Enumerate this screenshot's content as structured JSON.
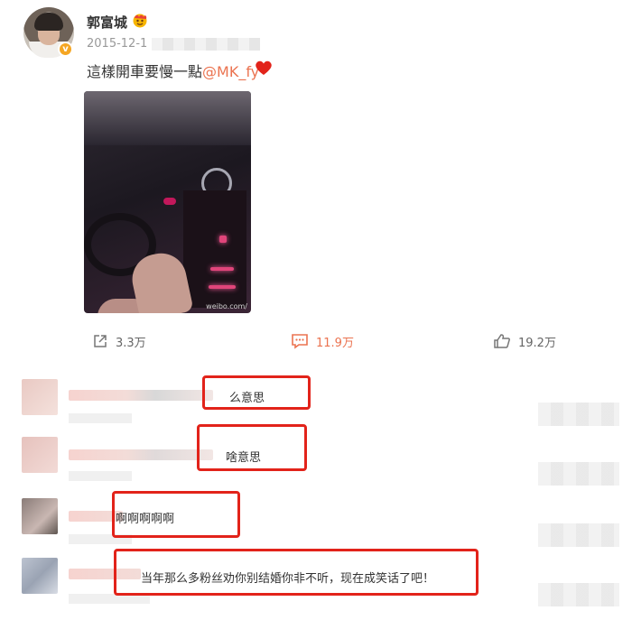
{
  "post": {
    "username": "郭富城",
    "date": "2015-12-1",
    "text": "這樣開車要慢一點",
    "mention": "@MK_fy",
    "image_watermark": "weibo.com/",
    "verified_icon": "verified-icon",
    "vip_icon": "vip-face-icon",
    "heart_icon": "heart-icon"
  },
  "actions": {
    "share": {
      "icon": "share-icon",
      "count": "3.3万"
    },
    "comment": {
      "icon": "comment-icon",
      "count": "11.9万"
    },
    "like": {
      "icon": "like-icon",
      "count": "19.2万"
    }
  },
  "comments": [
    {
      "text": "么意思"
    },
    {
      "text": "啥意思"
    },
    {
      "text": "啊啊啊啊啊"
    },
    {
      "text": "当年那么多粉丝劝你别结婚你非不听，现在成笑话了吧！"
    }
  ],
  "colors": {
    "accent": "#eb7350",
    "highlight_box": "#e2231a"
  }
}
